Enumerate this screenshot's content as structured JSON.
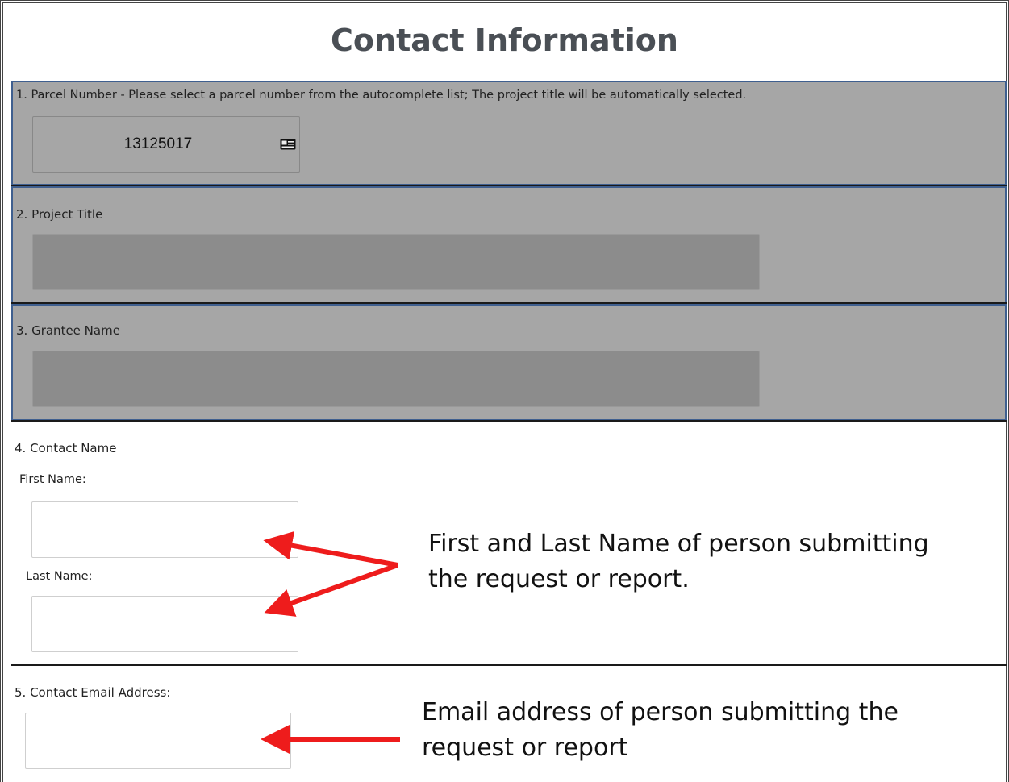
{
  "page": {
    "title": "Contact Information"
  },
  "sections": {
    "parcel": {
      "label": "1. Parcel Number - Please select a parcel number from the autocomplete list; The project title will be automatically selected.",
      "value": "13125017",
      "icon": "id-card-icon"
    },
    "project_title": {
      "label": "2. Project Title",
      "value": ""
    },
    "grantee_name": {
      "label": "3. Grantee Name",
      "value": ""
    },
    "contact_name": {
      "label": "4. Contact Name",
      "first_label": "First Name:",
      "first_value": "",
      "last_label": "Last Name:",
      "last_value": ""
    },
    "email": {
      "label": "5. Contact Email Address:",
      "value": ""
    }
  },
  "annotations": {
    "name_note_line1": "First and Last Name of person submitting",
    "name_note_line2": "the request or report.",
    "email_note_line1": "Email address of person submitting the",
    "email_note_line2": "request or report"
  },
  "colors": {
    "disabled_section": "#a6a6a6",
    "disabled_input": "#8c8c8c",
    "arrow": "#ee1c1c",
    "section_border": "#3f5f8f"
  }
}
